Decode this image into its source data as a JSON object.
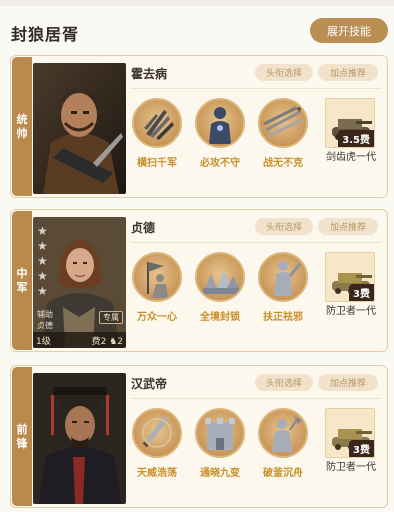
{
  "page": {
    "title": "封狼居胥",
    "expand_button": "展开技能"
  },
  "cards": [
    {
      "position": "统帅",
      "name": "霍去病",
      "title_button": "头衔选择",
      "points_button": "加点推荐",
      "skills": [
        "横扫千军",
        "必攻不守",
        "战无不克"
      ],
      "equipment": {
        "cost": "3.5费",
        "name": "剑齿虎一代"
      }
    },
    {
      "position": "中军",
      "name": "贞德",
      "title_button": "头衔选择",
      "points_button": "加点推荐",
      "portrait": {
        "assist_label": "辅助",
        "assist_name": "贞德",
        "expert": "专属",
        "level": "1级",
        "cost": "费2",
        "count": "2"
      },
      "skills": [
        "万众一心",
        "全境封锁",
        "扶正祛邪"
      ],
      "equipment": {
        "cost": "3费",
        "name": "防卫者一代"
      }
    },
    {
      "position": "前锋",
      "name": "汉武帝",
      "title_button": "头衔选择",
      "points_button": "加点推荐",
      "skills": [
        "天威浩荡",
        "通晓九变",
        "破釜沉舟"
      ],
      "equipment": {
        "cost": "3费",
        "name": "防卫者一代"
      }
    }
  ],
  "icons": {
    "skills_row1": [
      "knife-cluster-icon",
      "body-silhouette-icon",
      "spears-icon"
    ],
    "skills_row2": [
      "soldier-flag-icon",
      "siege-camp-icon",
      "warrior-statue-icon"
    ],
    "skills_row3": [
      "sword-icon",
      "wall-icon",
      "axe-warrior-icon"
    ],
    "equipment": [
      "tank-icon"
    ]
  },
  "colors": {
    "accent": "#b98f54",
    "skill_text": "#c98f2a",
    "position_tab": "#b98a4c"
  }
}
